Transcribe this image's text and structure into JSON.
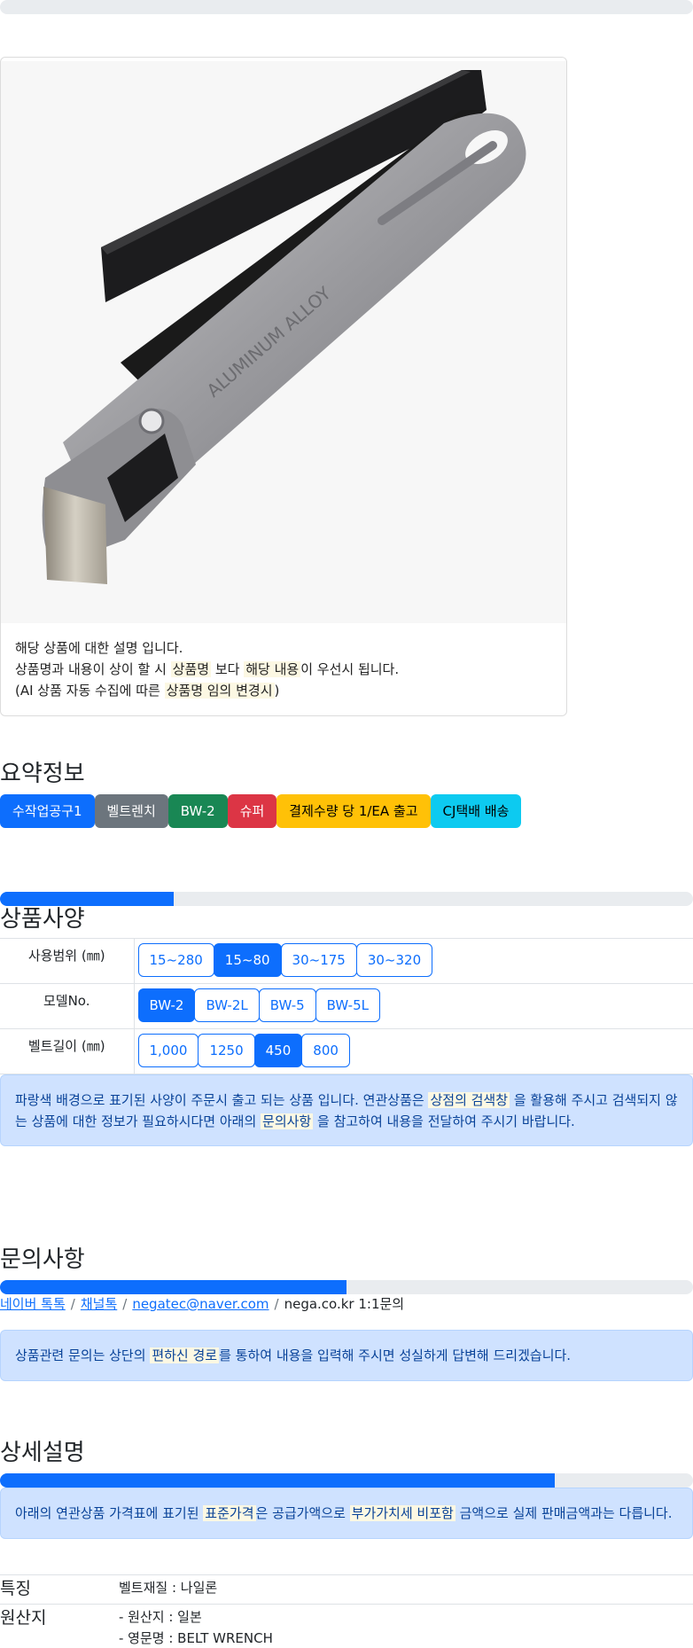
{
  "progress": {
    "top": 0,
    "specs": 0.25,
    "inquiry": 0.5,
    "detail": 0.8
  },
  "card": {
    "image_alt": "ALUMINUM ALLOY",
    "line1": "해당 상품에 대한 설명 입니다.",
    "line2_a": "상품명과 내용이 상이 할 시",
    "line2_m1": "상품명",
    "line2_b": "보다",
    "line2_m2": "해당 내용",
    "line2_c": "이 우선시 됩니다.",
    "line3_a": "(AI 상품 자동 수집에 따른",
    "line3_m": "상품명 임의 변경시",
    "line3_b": ")"
  },
  "summary": {
    "title": "요약정보",
    "badges": [
      "수작업공구1",
      "벨트렌치",
      "BW-2",
      "슈퍼",
      "결제수량 당 1/EA 출고",
      "CJ택배 배송"
    ]
  },
  "specs": {
    "title": "상품사양",
    "rows": [
      {
        "label": "사용범위 (㎜)",
        "options": [
          "15~280",
          "15~80",
          "30~175",
          "30~320"
        ],
        "selected": 1
      },
      {
        "label": "모델No.",
        "options": [
          "BW-2",
          "BW-2L",
          "BW-5",
          "BW-5L"
        ],
        "selected": 0
      },
      {
        "label": "벨트길이 (㎜)",
        "options": [
          "1,000",
          "1250",
          "450",
          "800"
        ],
        "selected": 2
      }
    ],
    "notice_a": "파랑색 배경으로 표기된 사양이 주문시 출고 되는 상품 입니다. 연관상품은",
    "notice_m1": "상점의 검색창",
    "notice_b": "을 활용해 주시고 검색되지 않는 상품에 대한 정보가 필요하시다면 아래의",
    "notice_m2": "문의사항",
    "notice_c": "을 참고하여 내용을 전달하여 주시기 바랍니다."
  },
  "inquiry": {
    "title": "문의사항",
    "links": [
      "네이버 톡톡",
      "채널톡",
      "negatec@naver.com"
    ],
    "plain": "nega.co.kr 1:1문의",
    "sep": "/",
    "notice_a": "상품관련 문의는 상단의",
    "notice_m": "편하신 경로",
    "notice_b": "를 통하여 내용을 입력해 주시면 성실하게 답변해 드리겠습니다."
  },
  "detail": {
    "title": "상세설명",
    "notice_a": "아래의 연관상품 가격표에 표기된",
    "notice_m1": "표준가격",
    "notice_b": "은 공급가액으로",
    "notice_m2": "부가가치세 비포함",
    "notice_c": "금액으로 실제 판매금액과는 다릅니다.",
    "features": [
      {
        "key": "특징",
        "values": [
          "벨트재질 : 나일론"
        ]
      },
      {
        "key": "원산지",
        "values": [
          "- 원산지 : 일본",
          "- 영문명 : BELT WRENCH"
        ]
      }
    ]
  },
  "colors": {
    "primary": "#0d6efd",
    "alert_bg": "#cfe2ff",
    "alert_text": "#084298",
    "mark": "#fcf8e3"
  }
}
